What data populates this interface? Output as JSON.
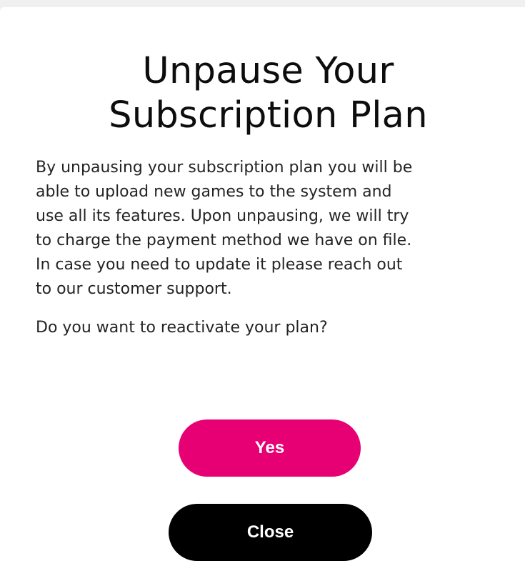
{
  "dialog": {
    "title": "Unpause Your\nSubscription Plan",
    "body": "By unpausing your subscription plan you will be\nable to upload new games to the system and\nuse all its features. Upon unpausing, we will try\nto charge the payment method we have on file.\nIn case you need to update it please reach out\nto our customer support.",
    "question": "Do you want to reactivate your plan?",
    "yes_label": "Yes",
    "close_label": "Close"
  },
  "colors": {
    "primary": "#e60073",
    "secondary": "#000000",
    "background": "#ffffff"
  }
}
